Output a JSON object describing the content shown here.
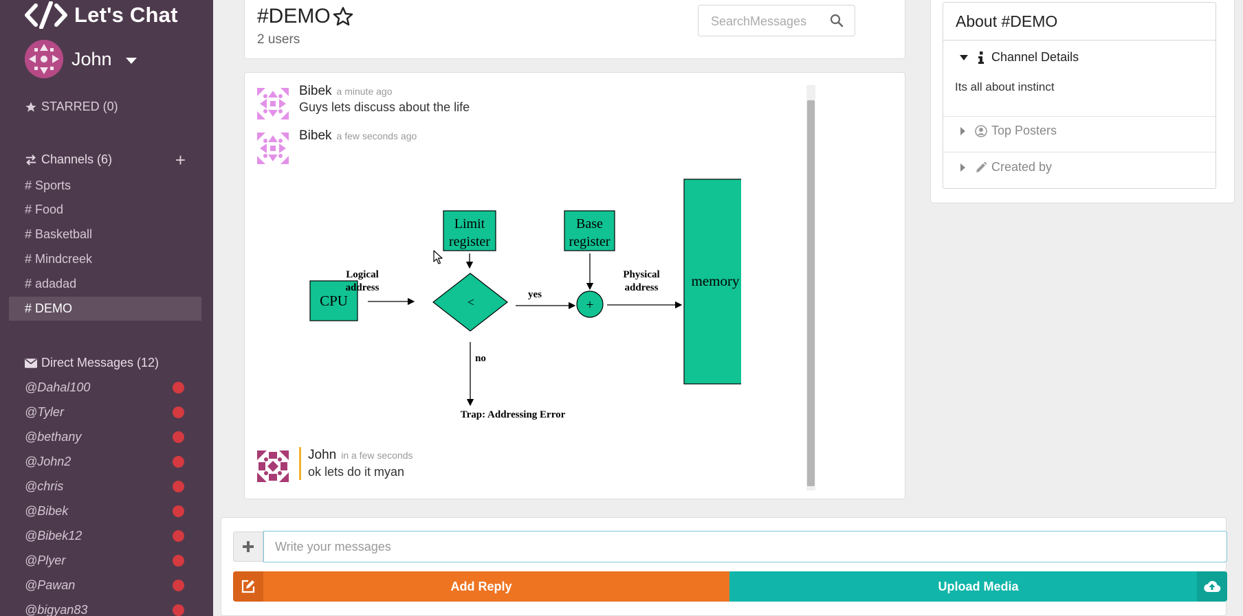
{
  "brand": {
    "name": "Let's Chat"
  },
  "user": {
    "name": "John"
  },
  "sidebar": {
    "starred_label": "STARRED (0)",
    "channels_header": "Channels (6)",
    "channels": [
      {
        "label": "# Sports"
      },
      {
        "label": "# Food"
      },
      {
        "label": "# Basketball"
      },
      {
        "label": "# Mindcreek"
      },
      {
        "label": "# adadad"
      },
      {
        "label": "# DEMO",
        "active": true
      }
    ],
    "dm_header": "Direct Messages (12)",
    "direct_messages": [
      {
        "label": "@Dahal100"
      },
      {
        "label": "@Tyler"
      },
      {
        "label": "@bethany"
      },
      {
        "label": "@John2"
      },
      {
        "label": "@chris"
      },
      {
        "label": "@Bibek"
      },
      {
        "label": "@Bibek12"
      },
      {
        "label": "@Plyer"
      },
      {
        "label": "@Pawan"
      },
      {
        "label": "@bigyan83"
      }
    ]
  },
  "channel": {
    "title": "#DEMO",
    "users": "2 users",
    "search_placeholder": "SearchMessages"
  },
  "messages": [
    {
      "author": "Bibek",
      "time": "a minute ago",
      "text": "Guys lets discuss about the life"
    },
    {
      "author": "Bibek",
      "time": "a few seconds ago",
      "text": ""
    },
    {
      "author": "John",
      "time": "in a few seconds",
      "text": "ok lets do it myan"
    }
  ],
  "diagram": {
    "cpu": "CPU",
    "logical_line1": "Logical",
    "logical_line2": "address",
    "limit_line1": "Limit",
    "limit_line2": "register",
    "compare": "<",
    "yes": "yes",
    "no": "no",
    "base_line1": "Base",
    "base_line2": "register",
    "plus": "+",
    "physical_line1": "Physical",
    "physical_line2": "address",
    "memory": "memory",
    "trap": "Trap: Addressing Error"
  },
  "about": {
    "title": "About #DEMO",
    "details_label": "Channel Details",
    "description": "Its all about instinct",
    "top_posters_label": "Top Posters",
    "created_by_label": "Created by"
  },
  "composer": {
    "placeholder": "Write your messages",
    "add_reply_label": "Add Reply",
    "upload_label": "Upload Media"
  },
  "colors": {
    "sidebar_bg": "#4e3a4d",
    "active_channel_bg": "#625061",
    "dm_status": "#d43a3f",
    "reply_button": "#ee7422",
    "upload_button": "#11b5a9",
    "diagram_fill": "#11c292"
  }
}
